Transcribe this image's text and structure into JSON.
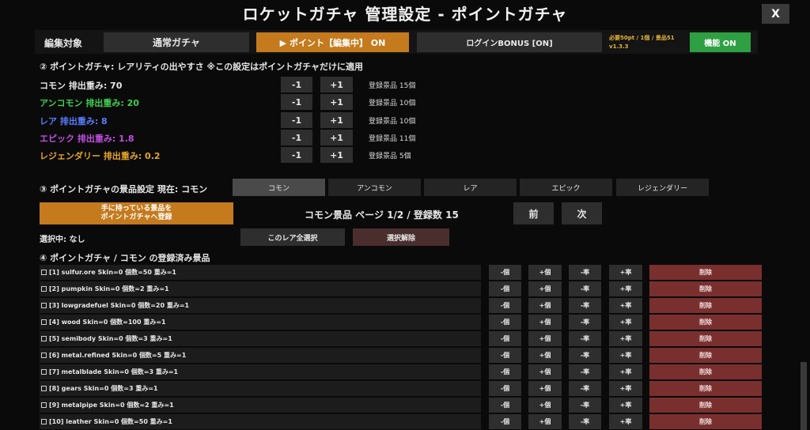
{
  "title": "ロケットガチャ 管理設定 - ポイントガチャ",
  "close_label": "X",
  "top": {
    "edit_target_label": "編集対象",
    "normal_label": "通常ガチャ",
    "point_label": "▶ ポイント【編集中】 ON",
    "login_label": "ログインBONUS [ON]",
    "required_text": "必要50pt / 1個 / 景品51",
    "version_text": "v1.3.3",
    "function_label": "機能 ON"
  },
  "section2": {
    "heading": "② ポイントガチャ: レアリティの出やすさ ※この設定はポイントガチャだけに適用",
    "minus_label": "-1",
    "plus_label": "+1",
    "rarities": [
      {
        "label": "コモン 排出重み: 70",
        "color": "#e6e6e6",
        "count": "登録景品 15個"
      },
      {
        "label": "アンコモン 排出重み: 20",
        "color": "#3fcf4f",
        "count": "登録景品 10個"
      },
      {
        "label": "レア 排出重み: 8",
        "color": "#5a7cff",
        "count": "登録景品 10個"
      },
      {
        "label": "エピック 排出重み: 1.8",
        "color": "#c14ee0",
        "count": "登録景品 11個"
      },
      {
        "label": "レジェンダリー 排出重み: 0.2",
        "color": "#e6a52a",
        "count": "登録景品 5個"
      }
    ]
  },
  "section3": {
    "heading": "③ ポイントガチャの景品設定 現在: コモン",
    "tabs": [
      "コモン",
      "アンコモン",
      "レア",
      "エピック",
      "レジェンダリー"
    ],
    "register_line1": "手に持っている景品を",
    "register_line2": "ポイントガチャへ登録",
    "page_info": "コモン景品 ページ 1/2 / 登録数 15",
    "prev_label": "前",
    "next_label": "次",
    "selection_text": "選択中: なし",
    "select_all_label": "このレア全選択",
    "deselect_label": "選択解除"
  },
  "section4": {
    "heading": "④ ポイントガチャ / コモン の登録済み景品",
    "minus_item": "-個",
    "plus_item": "+個",
    "minus_rate": "-率",
    "plus_rate": "+率",
    "delete_label": "削除",
    "items": [
      "[1] sulfur.ore Skin=0 個数=50 重み=1",
      "[2] pumpkin Skin=0 個数=2 重み=1",
      "[3] lowgradefuel Skin=0 個数=20 重み=1",
      "[4] wood Skin=0 個数=100 重み=1",
      "[5] semibody Skin=0 個数=3 重み=1",
      "[6] metal.refined Skin=0 個数=5 重み=1",
      "[7] metalblade Skin=0 個数=3 重み=1",
      "[8] gears Skin=0 個数=3 重み=1",
      "[9] metalpipe Skin=0 個数=2 重み=1",
      "[10] leather Skin=0 個数=50 重み=1"
    ]
  }
}
